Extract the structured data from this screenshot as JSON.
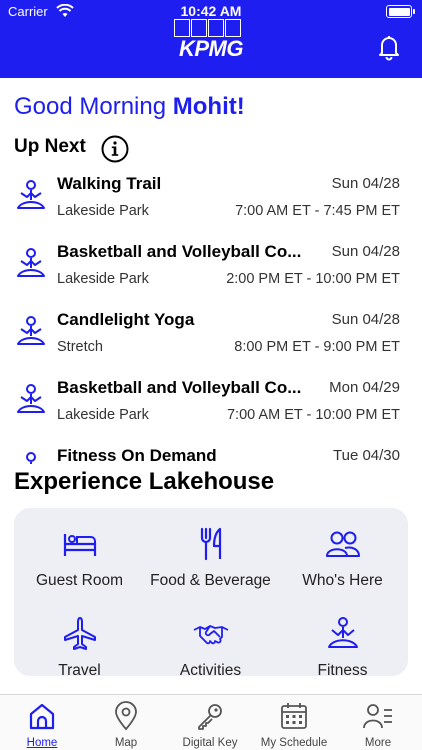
{
  "status_bar": {
    "carrier": "Carrier",
    "time": "10:42 AM"
  },
  "header": {
    "logo_text": "KPMG",
    "accent_color": "#1e1ef0"
  },
  "greeting": {
    "prefix": "Good Morning ",
    "name": "Mohit!"
  },
  "up_next": {
    "title": "Up Next"
  },
  "events": [
    {
      "title": "Walking Trail",
      "date": "Sun 04/28",
      "location": "Lakeside Park",
      "time": "7:00  AM ET - 7:45  PM ET",
      "icon": "yoga-person-icon"
    },
    {
      "title": "Basketball and Volleyball Co...",
      "date": "Sun 04/28",
      "location": "Lakeside Park",
      "time": "2:00  PM ET - 10:00  PM ET",
      "icon": "yoga-person-icon"
    },
    {
      "title": "Candlelight Yoga",
      "date": "Sun 04/28",
      "location": "Stretch",
      "time": "8:00  PM ET - 9:00  PM ET",
      "icon": "yoga-person-icon"
    },
    {
      "title": "Basketball and Volleyball Co...",
      "date": "Mon 04/29",
      "location": "Lakeside Park",
      "time": "7:00  AM ET - 10:00  PM ET",
      "icon": "yoga-person-icon"
    },
    {
      "title": "Fitness On Demand",
      "date": "Tue 04/30",
      "location": "",
      "time": "",
      "icon": "yoga-person-icon"
    }
  ],
  "experience": {
    "title": "Experience Lakehouse",
    "tiles": [
      {
        "label": "Guest Room",
        "icon": "bed-icon"
      },
      {
        "label": "Food & Beverage",
        "icon": "fork-knife-icon"
      },
      {
        "label": "Who's Here",
        "icon": "people-icon"
      },
      {
        "label": "Travel",
        "icon": "airplane-icon"
      },
      {
        "label": "Activities",
        "icon": "handshake-icon"
      },
      {
        "label": "Fitness",
        "icon": "yoga-person-icon"
      }
    ]
  },
  "tabs": [
    {
      "label": "Home",
      "icon": "home-icon",
      "active": true
    },
    {
      "label": "Map",
      "icon": "map-pin-icon",
      "active": false
    },
    {
      "label": "Digital Key",
      "icon": "key-icon",
      "active": false
    },
    {
      "label": "My Schedule",
      "icon": "calendar-icon",
      "active": false
    },
    {
      "label": "More",
      "icon": "more-menu-icon",
      "active": false
    }
  ]
}
